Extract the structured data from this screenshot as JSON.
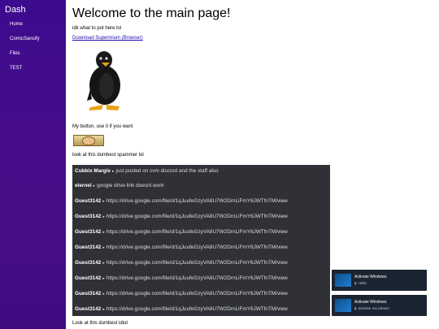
{
  "sidebar": {
    "brand": "Dash",
    "items": [
      {
        "label": "Home"
      },
      {
        "label": "ComicSansify"
      },
      {
        "label": "Files"
      },
      {
        "label": "TEST"
      }
    ]
  },
  "main": {
    "title": "Welcome to the main page!",
    "intro": "idk what to put here lol",
    "download_link": "Download Supermium (Browser)",
    "button_caption": "My button, use it if you want",
    "spammer_caption": "look at this dumbest spammer lol",
    "footer_caption": "Look at this dumbest idiot"
  },
  "chat": {
    "messages": [
      {
        "user": "Cubbix Margix",
        "text": "just posted on cvm discord and the staff also"
      },
      {
        "user": "elernel",
        "text": "google drive link doesnt work"
      },
      {
        "user": "Guest3142",
        "text": "https://drive.google.com/file/d/1qJuufeGzyVA8U7W2DrnLiFmY6JWTfnTM/view"
      },
      {
        "user": "Guest3142",
        "text": "https://drive.google.com/file/d/1qJuufeGzyVA8U7W2DrnLiFmY6JWTfnTM/view"
      },
      {
        "user": "Guest3142",
        "text": "https://drive.google.com/file/d/1qJuufeGzyVA8U7W2DrnLiFmY6JWTfnTM/view"
      },
      {
        "user": "Guest3142",
        "text": "https://drive.google.com/file/d/1qJuufeGzyVA8U7W2DrnLiFmY6JWTfnTM/view"
      },
      {
        "user": "Guest3142",
        "text": "https://drive.google.com/file/d/1qJuufeGzyVA8U7W2DrnLiFmY6JWTfnTM/view"
      },
      {
        "user": "Guest3142",
        "text": "https://drive.google.com/file/d/1qJuufeGzyVA8U7W2DrnLiFmY6JWTfnTM/view"
      },
      {
        "user": "Guest3142",
        "text": "https://drive.google.com/file/d/1qJuufeGzyVA8U7W2DrnLiFmY6JWTfnTM/view"
      },
      {
        "user": "Guest3142",
        "text": "https://drive.google.com/file/d/1qJuufeGzyVA8U7W2DrnLiFmY6JWTfnTM/view"
      }
    ]
  },
  "toasts": [
    {
      "title": "Activate Windows",
      "text": "Hello"
    },
    {
      "title": "Activate Windows",
      "text": "activate me please"
    }
  ],
  "colors": {
    "sidebar": "#4a0d8a",
    "chat_bg": "#2f3136",
    "link": "#1a0dab",
    "toast_bg": "#1b2431"
  }
}
